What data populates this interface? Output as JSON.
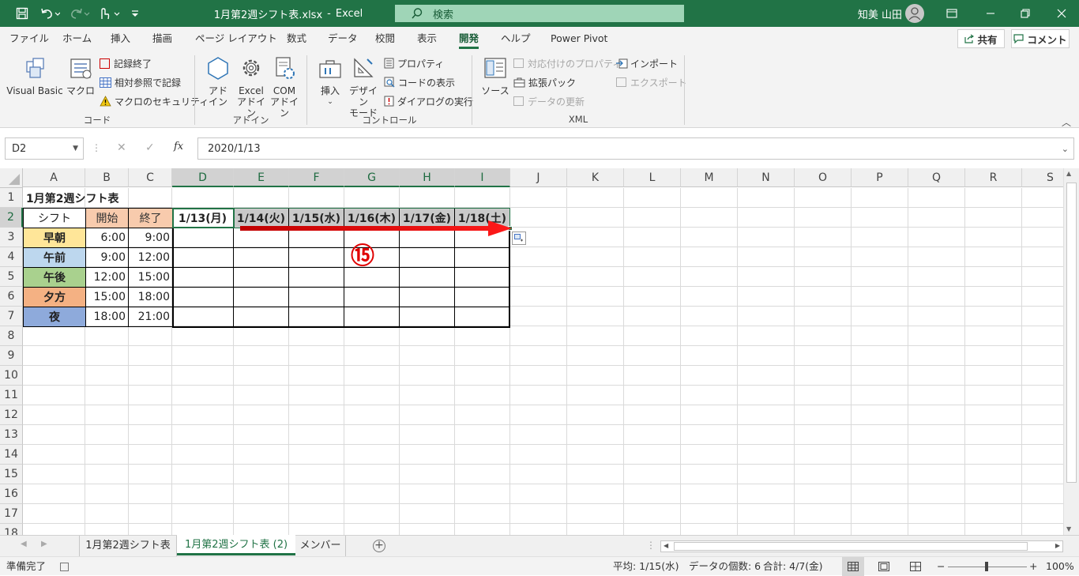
{
  "titlebar": {
    "save_icon": "save-icon",
    "file_title": "1月第2週シフト表.xlsx",
    "separator": "-",
    "app_name": "Excel",
    "search_placeholder": "検索",
    "user_name": "知美 山田"
  },
  "tabs": [
    "ファイル",
    "ホーム",
    "挿入",
    "描画",
    "ページ レイアウト",
    "数式",
    "データ",
    "校閲",
    "表示",
    "開発",
    "ヘルプ",
    "Power Pivot"
  ],
  "active_tab": "開発",
  "share_label": "共有",
  "comment_label": "コメント",
  "ribbon": {
    "code": {
      "label": "コード",
      "visual_basic": "Visual Basic",
      "macro": "マクロ",
      "record": "記録終了",
      "relative": "相対参照で記録",
      "security": "マクロのセキュリティ"
    },
    "addin": {
      "label": "アドイン",
      "addin": "アド\nイン",
      "excel_addin": "Excel\nアドイン",
      "com_addin": "COM\nアドイン"
    },
    "control": {
      "label": "コントロール",
      "insert": "挿入",
      "design_mode": "デザイン\nモード",
      "properties": "プロパティ",
      "view_code": "コードの表示",
      "run_dialog": "ダイアログの実行"
    },
    "xml": {
      "label": "XML",
      "source": "ソース",
      "map_props": "対応付けのプロパティ",
      "expansion": "拡張パック",
      "refresh": "データの更新",
      "import": "インポート",
      "export": "エクスポート"
    }
  },
  "formula_bar": {
    "name_box": "D2",
    "fx": "fx",
    "value": "2020/1/13"
  },
  "columns": [
    "A",
    "B",
    "C",
    "D",
    "E",
    "F",
    "G",
    "H",
    "I",
    "J",
    "K",
    "L",
    "M",
    "N",
    "O",
    "P",
    "Q",
    "R",
    "S"
  ],
  "rows": [
    "1",
    "2",
    "3",
    "4",
    "5",
    "6",
    "7",
    "8",
    "9",
    "10",
    "11",
    "12",
    "13",
    "14",
    "15",
    "16",
    "17",
    "18"
  ],
  "sheet": {
    "title": "1月第2週シフト表",
    "header": [
      "シフト",
      "開始",
      "終了"
    ],
    "dates": [
      "1/13(月)",
      "1/14(火)",
      "1/15(水)",
      "1/16(木)",
      "1/17(金)",
      "1/18(土)"
    ],
    "shifts": [
      {
        "name": "早朝",
        "start": "6:00",
        "end": "9:00",
        "color": "#ffe699"
      },
      {
        "name": "午前",
        "start": "9:00",
        "end": "12:00",
        "color": "#bdd7ee"
      },
      {
        "name": "午後",
        "start": "12:00",
        "end": "15:00",
        "color": "#a9d18e"
      },
      {
        "name": "夕方",
        "start": "15:00",
        "end": "18:00",
        "color": "#f4b183"
      },
      {
        "name": "夜",
        "start": "18:00",
        "end": "21:00",
        "color": "#8eaadb"
      }
    ],
    "start_end_header_color": "#f8cbad"
  },
  "annotation": "⑮",
  "sheet_tabs": [
    "1月第2週シフト表",
    "1月第2週シフト表 (2)",
    "メンバー"
  ],
  "active_sheet": "1月第2週シフト表 (2)",
  "status": {
    "ready": "準備完了",
    "average": "平均: 1/15(水)",
    "count": "データの個数: 6",
    "sum": "合計: 4/7(金)",
    "zoom": "100%"
  },
  "colors": {
    "excel_green": "#217346",
    "arrow_red": "#e00000"
  }
}
